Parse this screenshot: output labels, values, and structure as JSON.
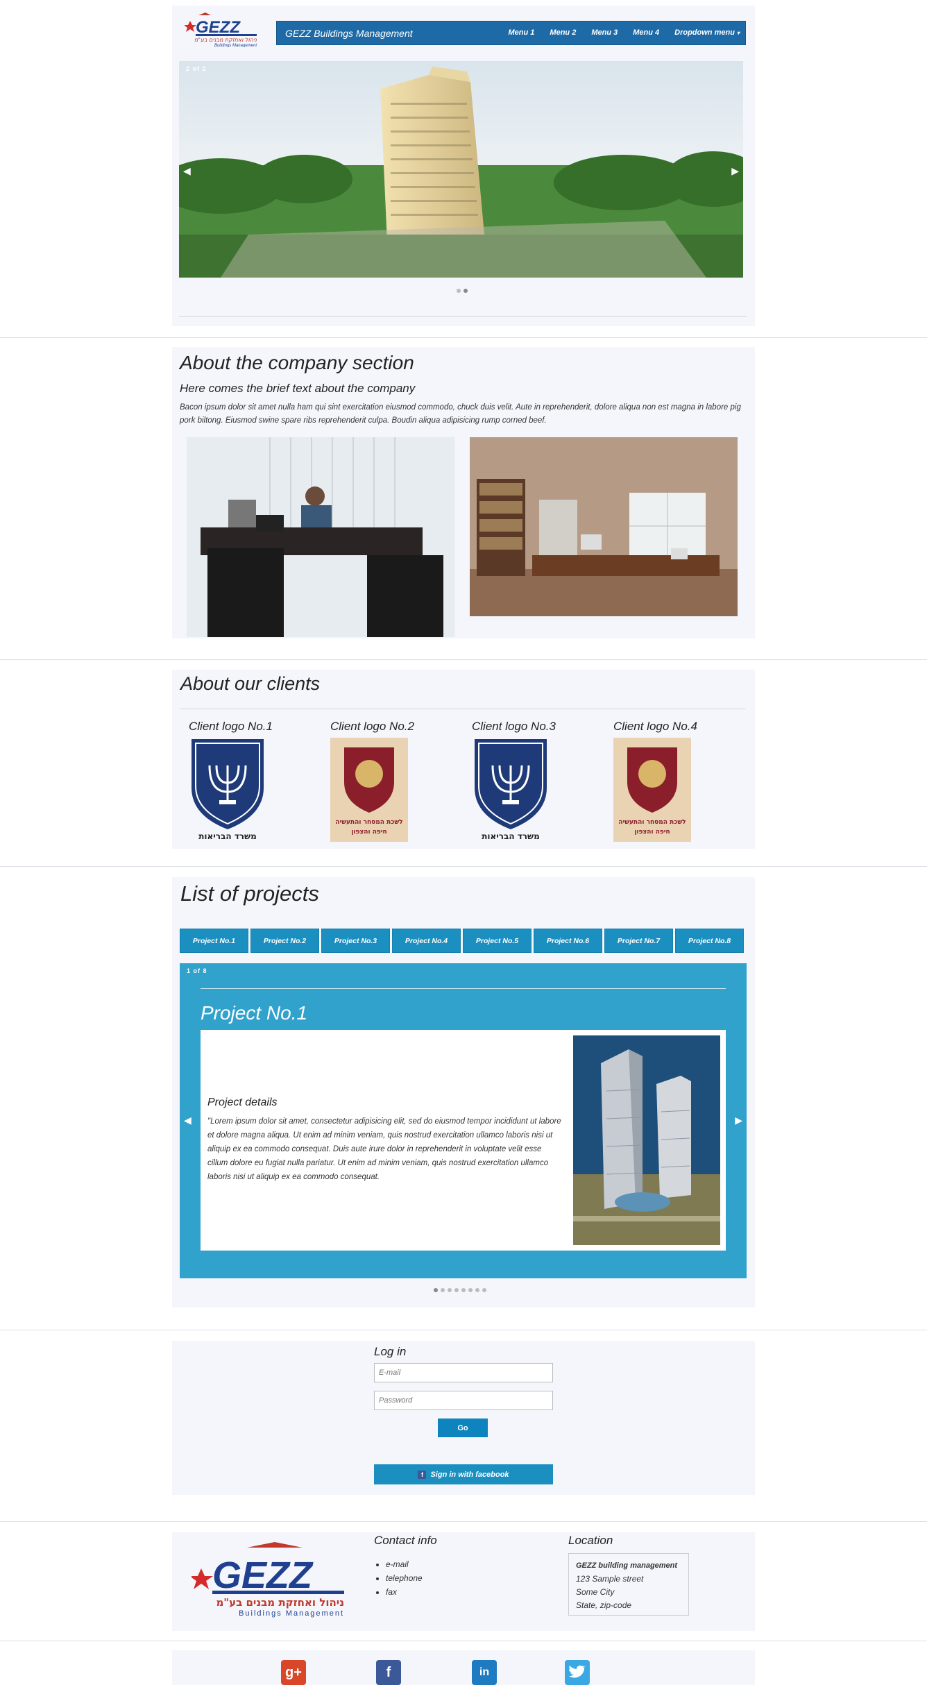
{
  "header": {
    "logo_text": "GEZZ",
    "logo_hebrew": "ניהול ואחזקת מבנים בע\"מ",
    "logo_tagline": "Buildings Management",
    "brand": "GEZZ Buildings Management",
    "menu": [
      "Menu 1",
      "Menu 2",
      "Menu 3",
      "Menu 4",
      "Dropdown menu"
    ],
    "slider_counter": "2 of 2"
  },
  "about": {
    "title": "About the company section",
    "subtitle": "Here comes the brief text about the company",
    "body": "Bacon ipsum dolor sit amet nulla ham qui sint exercitation eiusmod commodo, chuck duis velit. Aute in reprehenderit, dolore aliqua non est magna in labore pig pork biltong. Eiusmod swine spare ribs reprehenderit culpa. Boudin aliqua adipisicing rump corned beef."
  },
  "clients": {
    "title": "About our clients",
    "items": [
      {
        "label": "Client logo No.1",
        "logo_caption": "משרד הבריאות"
      },
      {
        "label": "Client logo No.2",
        "logo_caption": "לשכת המסחר והתעשיה חיפה והצפון"
      },
      {
        "label": "Client logo No.3",
        "logo_caption": "משרד הבריאות"
      },
      {
        "label": "Client logo No.4",
        "logo_caption": "לשכת המסחר והתעשיה חיפה והצפון"
      }
    ]
  },
  "projects": {
    "title": "List of projects",
    "tabs": [
      "Project No.1",
      "Project No.2",
      "Project No.3",
      "Project No.4",
      "Project No.5",
      "Project No.6",
      "Project No.7",
      "Project No.8"
    ],
    "counter": "1 of 8",
    "current_title": "Project No.1",
    "details_heading": "Project details",
    "details_text": "\"Lorem ipsum dolor sit amet, consectetur adipisicing elit, sed do eiusmod tempor incididunt ut labore et dolore magna aliqua. Ut enim ad minim veniam, quis nostrud exercitation ullamco laboris nisi ut aliquip ex ea commodo consequat. Duis aute irure dolor in reprehenderit in voluptate velit esse cillum dolore eu fugiat nulla pariatur. Ut enim ad minim veniam, quis nostrud exercitation ullamco laboris nisi ut aliquip ex ea commodo consequat."
  },
  "login": {
    "title": "Log in",
    "email_placeholder": "E-mail",
    "password_placeholder": "Password",
    "go_label": "Go",
    "facebook_label": "Sign in with facebook"
  },
  "footer": {
    "contact_title": "Contact info",
    "contact_items": [
      "e-mail",
      "telephone",
      "fax"
    ],
    "location_title": "Location",
    "address_name": "GEZZ building management",
    "address_street": "123 Sample street",
    "address_city": "Some City",
    "address_state": "State, zip-code"
  },
  "social": [
    "google-plus-icon",
    "facebook-icon",
    "linkedin-icon",
    "twitter-icon"
  ],
  "colors": {
    "navbar": "#1e6aa6",
    "accent": "#31a2cc",
    "tab": "#1a8fc0",
    "panel": "#f4f6fb"
  }
}
